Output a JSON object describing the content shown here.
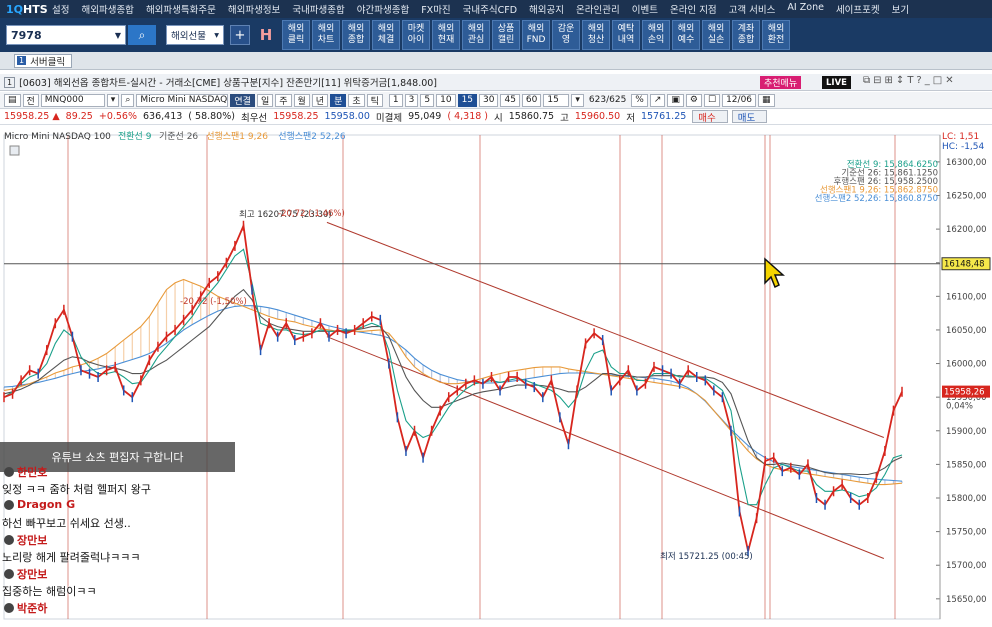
{
  "app": {
    "logo_num": "1Q",
    "logo_text": "HTS"
  },
  "menu": [
    "설정",
    "해외파생종합",
    "해외파생특화주문",
    "해외파생정보",
    "국내파생종합",
    "야간파생종합",
    "FX마진",
    "국내주식CFD",
    "해외공지",
    "온라인관리",
    "이벤트",
    "온라인 지점",
    "고객 서비스",
    "AI Zone",
    "세이프포켓",
    "보기"
  ],
  "toolbar": {
    "code_value": "7978",
    "market_label": "해외선물",
    "buttons": [
      "해외\n클릭",
      "해외\n차트",
      "해외\n종합",
      "해외\n체결",
      "마켓\n아이",
      "해외\n현재",
      "해외\n관심",
      "상품\n캘린",
      "해외\nFND",
      "감운\n영",
      "해외\n청산",
      "예탁\n내역",
      "해외\n손익",
      "해외\n예수",
      "해외\n실손",
      "계좌\n종합",
      "해외\n환전"
    ]
  },
  "subtab": {
    "num": "1",
    "label": "서버클릭"
  },
  "window": {
    "num": "1",
    "title": "[0603] 해외선옵 종합차트-실시간 - 거래소[CME] 상품구분[지수] 잔존만기[11] 위탁증거금[1,848.00]",
    "recommend_label": "추천메뉴",
    "live_label": "LIVE",
    "icons": [
      "⧉",
      "⊟",
      "⊞",
      "↕",
      "T",
      "?",
      "_",
      "□",
      "✕"
    ]
  },
  "chartbar": {
    "jeon": "전",
    "symbol": "MNQ000",
    "name": "Micro Mini NASDAQ 10",
    "link_btn": "연결",
    "periods": [
      "일",
      "주",
      "월",
      "년",
      "분",
      "초",
      "틱"
    ],
    "intervals": [
      "1",
      "3",
      "5",
      "10",
      "15",
      "30",
      "45",
      "60"
    ],
    "selected_interval": "15",
    "period_sel": "분",
    "count_value": "15",
    "count_range": "623/625",
    "date": "12/06"
  },
  "pricebar": {
    "price": "15958.25 ▲",
    "change": "89.25",
    "change_pct": "+0.56%",
    "volume": "636,413",
    "vol_pct": "( 58.80%)",
    "best_label": "최우선",
    "best_value": "15958.25",
    "best_value2": "15958.00",
    "unfilled_label": "미결제",
    "unfilled_value": "95,049",
    "unfilled_change": "( 4,318 )",
    "open_label": "시",
    "open_value": "15860.75",
    "high_label": "고",
    "high_value": "15960.50",
    "low_label": "저",
    "low_value": "15761.25",
    "buy_label": "매수",
    "sell_label": "매도"
  },
  "legend": {
    "symbol": "Micro Mini NASDAQ 100",
    "items": [
      {
        "label": "전환선 9",
        "color": "#1ba08a"
      },
      {
        "label": "기준선 26",
        "color": "#555555"
      },
      {
        "label": "선행스팬1 9,26",
        "color": "#e89a3a"
      },
      {
        "label": "선행스팬2 52,26",
        "color": "#4b8fd6"
      }
    ],
    "lc": "LC: 1,51",
    "hc": "HC: -1,54"
  },
  "right_legend": [
    {
      "text": "전환선 9: 15,864.6250",
      "color": "#1ba08a"
    },
    {
      "text": "기준선 26: 15,861.1250",
      "color": "#555555"
    },
    {
      "text": "후행스팬 26: 15,958.2500",
      "color": "#555555"
    },
    {
      "text": "선행스팬1 9,26: 15,862.8750",
      "color": "#e89a3a"
    },
    {
      "text": "선행스팬2 52,26: 15,860.8750",
      "color": "#4b8fd6"
    }
  ],
  "annotations": {
    "high_label": "최고 16207.75 (23:30)",
    "high_pct": "-20,72 (-1,46%)",
    "mid_pct": "-20,72 (-1,50%)",
    "low_label": "최저 15721.25 (00:45)"
  },
  "chart_data": {
    "type": "line",
    "title": "Micro Mini NASDAQ 100",
    "ylim": [
      15620,
      16340
    ],
    "yticks": [
      16300,
      16250,
      16200,
      16150,
      16100,
      16050,
      16000,
      15950,
      15900,
      15850,
      15800,
      15750,
      15700,
      15650
    ],
    "ytick_labels": [
      "16300,00",
      "16250,00",
      "16200,00",
      "16150,00",
      "16100,00",
      "16050,00",
      "16000,00",
      "15950,00",
      "15900,00",
      "15850,00",
      "15800,00",
      "15750,00",
      "15700,00",
      "15650,00"
    ],
    "current_price": 15958.26,
    "current_price_label": "15958,26",
    "current_pct_label": "0,04%",
    "hline_value": 16148.48,
    "hline_label": "16148,48",
    "series": [
      {
        "name": "가격",
        "color": "#d7261e",
        "values": [
          15950,
          15955,
          15975,
          15990,
          15985,
          16020,
          16060,
          16080,
          16040,
          15990,
          15985,
          15980,
          15990,
          15995,
          15960,
          15950,
          15975,
          16005,
          16025,
          16040,
          16050,
          16065,
          16080,
          16100,
          16120,
          16130,
          16150,
          16175,
          16205,
          16110,
          16020,
          16060,
          16040,
          16060,
          16035,
          16040,
          16045,
          16060,
          16040,
          16050,
          16045,
          16050,
          16060,
          16070,
          16065,
          16000,
          15920,
          15870,
          15900,
          15860,
          15900,
          15930,
          15950,
          15960,
          15970,
          15975,
          15970,
          15980,
          15960,
          15980,
          15980,
          15970,
          15965,
          15950,
          15975,
          15920,
          15880,
          15960,
          16030,
          16045,
          16035,
          15960,
          15975,
          15990,
          15960,
          15970,
          15995,
          15990,
          15985,
          15970,
          15990,
          15980,
          15975,
          15960,
          15950,
          15900,
          15780,
          15721,
          15770,
          15855,
          15860,
          15840,
          15845,
          15835,
          15850,
          15800,
          15790,
          15810,
          15820,
          15800,
          15790,
          15800,
          15830,
          15870,
          15930,
          15958
        ]
      },
      {
        "name": "전환선 9",
        "color": "#1ba08a",
        "values": [
          15950,
          15958,
          15970,
          15980,
          15985,
          16000,
          16030,
          16050,
          16040,
          16010,
          15995,
          15985,
          15985,
          15988,
          15980,
          15970,
          15972,
          15990,
          16010,
          16025,
          16040,
          16055,
          16070,
          16090,
          16105,
          16120,
          16140,
          16160,
          16170,
          16120,
          16060,
          16055,
          16050,
          16050,
          16045,
          16043,
          16045,
          16050,
          16048,
          16048,
          16050,
          16050,
          16055,
          16060,
          16055,
          16020,
          15960,
          15915,
          15900,
          15890,
          15895,
          15915,
          15935,
          15950,
          15962,
          15970,
          15972,
          15975,
          15972,
          15975,
          15978,
          15975,
          15970,
          15965,
          15960,
          15950,
          15935,
          15950,
          15990,
          16015,
          16020,
          15995,
          15985,
          15985,
          15975,
          15975,
          15985,
          15985,
          15985,
          15980,
          15982,
          15980,
          15978,
          15970,
          15960,
          15930,
          15850,
          15790,
          15790,
          15820,
          15845,
          15850,
          15845,
          15840,
          15840,
          15820,
          15810,
          15810,
          15812,
          15808,
          15802,
          15805,
          15815,
          15835,
          15860,
          15864
        ]
      },
      {
        "name": "기준선 26",
        "color": "#555555",
        "values": [
          15955,
          15958,
          15962,
          15968,
          15975,
          15985,
          15995,
          16005,
          16010,
          16008,
          16002,
          15998,
          15995,
          15993,
          15990,
          15985,
          15985,
          15990,
          15998,
          16005,
          16015,
          16025,
          16035,
          16045,
          16055,
          16070,
          16085,
          16100,
          16110,
          16095,
          16070,
          16060,
          16055,
          16052,
          16050,
          16048,
          16048,
          16048,
          16048,
          16048,
          16048,
          16050,
          16052,
          16055,
          16055,
          16040,
          16010,
          15980,
          15960,
          15945,
          15935,
          15935,
          15940,
          15945,
          15950,
          15955,
          15958,
          15960,
          15962,
          15965,
          15968,
          15968,
          15968,
          15967,
          15965,
          15962,
          15958,
          15958,
          15965,
          15975,
          15985,
          15985,
          15982,
          15982,
          15980,
          15980,
          15982,
          15982,
          15982,
          15982,
          15980,
          15980,
          15980,
          15978,
          15972,
          15955,
          15920,
          15885,
          15860,
          15850,
          15850,
          15852,
          15850,
          15848,
          15846,
          15842,
          15838,
          15836,
          15836,
          15836,
          15835,
          15835,
          15838,
          15845,
          15855,
          15861
        ]
      },
      {
        "name": "선행스팬1 9,26",
        "color": "#e89a3a",
        "values": [
          15960,
          15962,
          15966,
          15970,
          15975,
          15980,
          15986,
          15990,
          15995,
          15998,
          16002,
          16008,
          16015,
          16025,
          16035,
          16045,
          16055,
          16070,
          16090,
          16110,
          16120,
          16125,
          16120,
          16115,
          16108,
          16100,
          16095,
          16090,
          16085,
          16080,
          16075,
          16070,
          16066,
          16064,
          16062,
          16058,
          16055,
          16052,
          16050,
          16048,
          16048,
          16048,
          16048,
          16049,
          16050,
          16045,
          16030,
          16010,
          15995,
          15985,
          15978,
          15972,
          15970,
          15970,
          15972,
          15975,
          15978,
          15982,
          15985,
          15988,
          15990,
          15992,
          15994,
          15995,
          15995,
          15995,
          15992,
          15990,
          15988,
          15986,
          15984,
          15982,
          15980,
          15978,
          15976,
          15974,
          15972,
          15970,
          15968,
          15966,
          15962,
          15955,
          15945,
          15930,
          15915,
          15900,
          15885,
          15870,
          15858,
          15850,
          15845,
          15842,
          15840,
          15838,
          15836,
          15834,
          15832,
          15830,
          15828,
          15826,
          15824,
          15822,
          15820,
          15820,
          15821,
          15822
        ]
      },
      {
        "name": "선행스팬2 52,26",
        "color": "#4b8fd6",
        "values": [
          15965,
          15966,
          15968,
          15970,
          15972,
          15975,
          15978,
          15982,
          15985,
          15988,
          15990,
          15992,
          15995,
          15998,
          16002,
          16006,
          16010,
          16015,
          16022,
          16030,
          16040,
          16050,
          16058,
          16065,
          16072,
          16078,
          16082,
          16085,
          16086,
          16086,
          16085,
          16083,
          16080,
          16076,
          16072,
          16068,
          16064,
          16060,
          16056,
          16053,
          16050,
          16048,
          16046,
          16044,
          16042,
          16038,
          16030,
          16020,
          16008,
          15998,
          15990,
          15984,
          15980,
          15976,
          15974,
          15972,
          15971,
          15971,
          15972,
          15973,
          15975,
          15977,
          15979,
          15981,
          15983,
          15985,
          15986,
          15986,
          15986,
          15985,
          15984,
          15983,
          15982,
          15981,
          15980,
          15979,
          15978,
          15976,
          15974,
          15970,
          15964,
          15955,
          15944,
          15930,
          15916,
          15902,
          15890,
          15878,
          15868,
          15860,
          15854,
          15850,
          15847,
          15845,
          15843,
          15841,
          15839,
          15837,
          15835,
          15833,
          15831,
          15829,
          15828,
          15827,
          15826,
          15825
        ]
      }
    ],
    "channel_upper": [
      [
        0.345,
        16210
      ],
      [
        0.94,
        15890
      ]
    ],
    "channel_lower": [
      [
        0.345,
        16040
      ],
      [
        0.94,
        15710
      ]
    ]
  },
  "chat": {
    "banner": "유튜브 쇼츠 편집자 구합니다",
    "messages": [
      {
        "name": "한민호",
        "name_color": "#c41b1b",
        "text": "잊정 ㅋㅋ 줌하 처럼 헬퍼지 왕구"
      },
      {
        "name": "Dragon G",
        "name_color": "#c41b1b",
        "text": "하선 빠꾸보고 쉬세요 선생.."
      },
      {
        "name": "장만보",
        "name_color": "#c41b1b",
        "text": "노리랑 해게 팔려줄럭냐ㅋㅋㅋ"
      },
      {
        "name": "장만보",
        "name_color": "#c41b1b",
        "text": "집중하는 해럼이ㅋㅋ"
      },
      {
        "name": "박준하",
        "name_color": "#c41b1b",
        "text": ""
      }
    ]
  }
}
